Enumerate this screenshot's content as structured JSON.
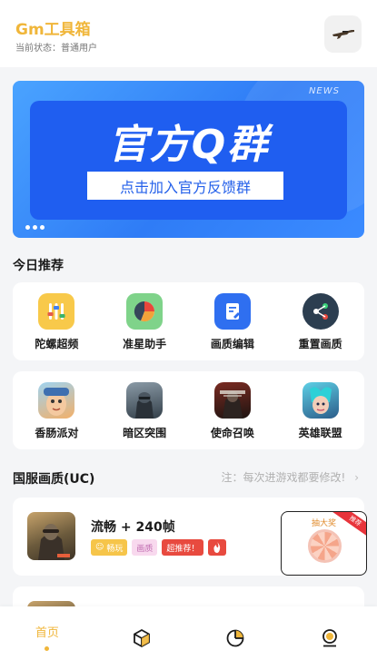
{
  "header": {
    "title": "Gm工具箱",
    "status": "当前状态：普通用户",
    "action_icon": "rifle-icon"
  },
  "banner": {
    "tag": "NEWS",
    "title": "官方Q群",
    "cta": "点击加入官方反馈群",
    "page_dots": 3
  },
  "recommend": {
    "title": "今日推荐",
    "tools": [
      {
        "label": "陀螺超频",
        "icon": "gyro-sliders-icon",
        "color": "#f8c94a"
      },
      {
        "label": "准星助手",
        "icon": "crosshair-pie-icon",
        "color": "#7fd38a"
      },
      {
        "label": "画质编辑",
        "icon": "quality-edit-icon",
        "color": "#2f6ff0"
      },
      {
        "label": "重置画质",
        "icon": "reset-share-icon",
        "color": "#2c3e50"
      }
    ],
    "games": [
      {
        "label": "香肠派对",
        "icon": "sausage-party-icon"
      },
      {
        "label": "暗区突围",
        "icon": "arena-breakout-icon"
      },
      {
        "label": "使命召唤",
        "icon": "call-of-duty-icon"
      },
      {
        "label": "英雄联盟",
        "icon": "league-of-legends-icon"
      }
    ]
  },
  "quality": {
    "title": "国服画质(UC)",
    "note": "注：每次进游戏都要修改!",
    "items": [
      {
        "name": "流畅 + 240帧",
        "tags": [
          "畅玩",
          "画质",
          "超推荐！"
        ],
        "fire_icon": "fire-icon"
      }
    ],
    "lottery": {
      "title": "抽大奖",
      "ribbon": "推荐"
    }
  },
  "tabbar": {
    "tabs": [
      {
        "label": "首页",
        "icon": "home-tab",
        "active": true
      },
      {
        "label": "",
        "icon": "cube-icon",
        "active": false
      },
      {
        "label": "",
        "icon": "pie-chart-icon",
        "active": false
      },
      {
        "label": "",
        "icon": "profile-icon",
        "active": false
      }
    ]
  },
  "colors": {
    "accent": "#f0b63a",
    "banner": "#2f7cf6",
    "background": "#f4f5f7"
  }
}
